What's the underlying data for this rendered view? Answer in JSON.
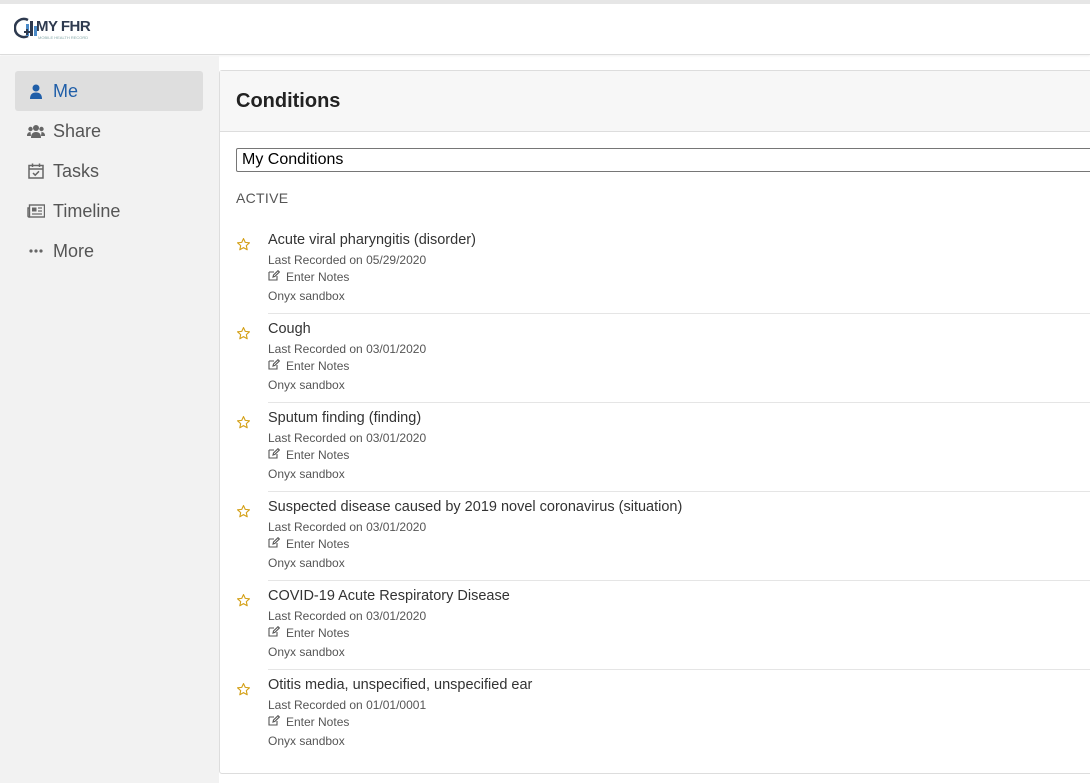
{
  "header": {
    "logo_text": "MY FHR",
    "logo_subtext": "MOBILE HEALTH RECORD"
  },
  "sidebar": {
    "items": [
      {
        "label": "Me",
        "icon": "user-icon",
        "active": true
      },
      {
        "label": "Share",
        "icon": "users-icon",
        "active": false
      },
      {
        "label": "Tasks",
        "icon": "calendar-check-icon",
        "active": false
      },
      {
        "label": "Timeline",
        "icon": "newspaper-icon",
        "active": false
      },
      {
        "label": "More",
        "icon": "ellipsis-icon",
        "active": false
      }
    ]
  },
  "main": {
    "title": "Conditions",
    "select_value": "My Conditions",
    "section_label": "ACTIVE",
    "notes_label": "Enter Notes",
    "conditions": [
      {
        "name": "Acute viral pharyngitis (disorder)",
        "recorded": "Last Recorded on 05/29/2020",
        "source": "Onyx sandbox"
      },
      {
        "name": "Cough",
        "recorded": "Last Recorded on 03/01/2020",
        "source": "Onyx sandbox"
      },
      {
        "name": "Sputum finding (finding)",
        "recorded": "Last Recorded on 03/01/2020",
        "source": "Onyx sandbox"
      },
      {
        "name": "Suspected disease caused by 2019 novel coronavirus (situation)",
        "recorded": "Last Recorded on 03/01/2020",
        "source": "Onyx sandbox"
      },
      {
        "name": "COVID-19 Acute Respiratory Disease",
        "recorded": "Last Recorded on 03/01/2020",
        "source": "Onyx sandbox"
      },
      {
        "name": "Otitis media, unspecified, unspecified ear",
        "recorded": "Last Recorded on 01/01/0001",
        "source": "Onyx sandbox"
      }
    ]
  },
  "colors": {
    "accent": "#1f5ea8",
    "star": "#d4a017",
    "sidebar_bg": "#f2f2f2"
  }
}
